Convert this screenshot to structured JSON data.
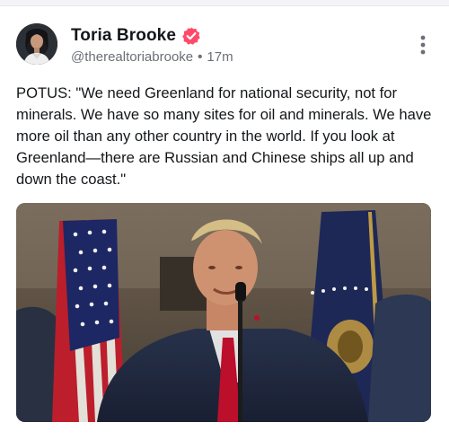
{
  "post": {
    "author": {
      "display_name": "Toria Brooke",
      "handle": "@therealtoriabrooke",
      "separator": "•",
      "timestamp": "17m",
      "verified": true,
      "verified_color": "#ff4a6b"
    },
    "text": "POTUS: \"We need Greenland for national security, not for minerals. We have so many sites for oil and minerals. We have more oil than any other country in the world. If you look at Greenland—there are Russian and Chinese ships all up and down the coast.\"",
    "menu_icon": "more-vertical-icon",
    "media": {
      "type": "video-thumbnail"
    }
  }
}
